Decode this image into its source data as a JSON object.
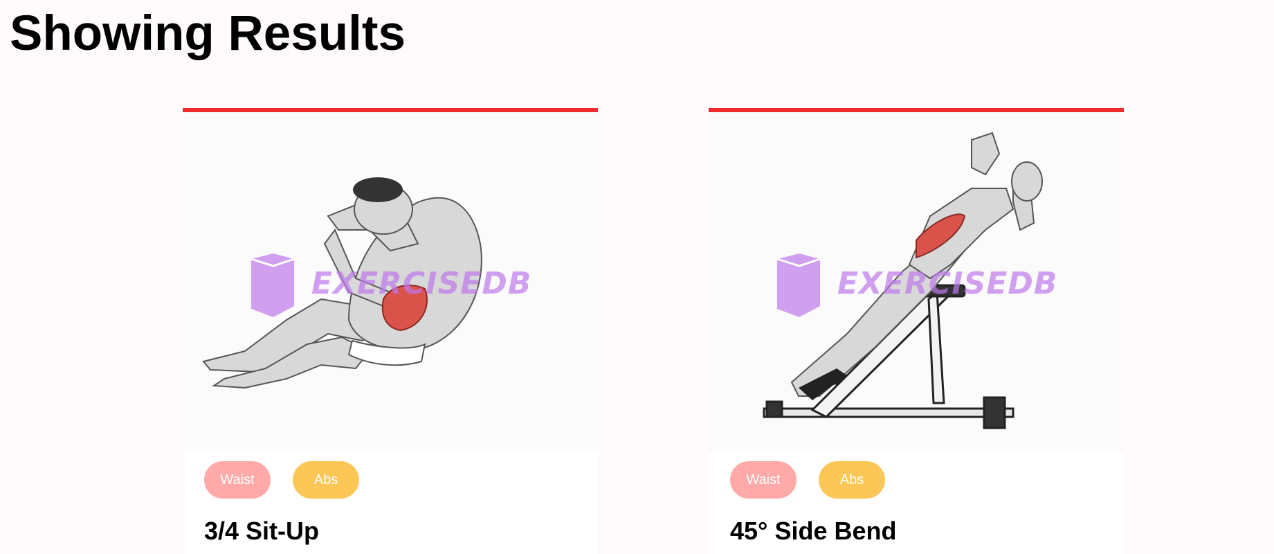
{
  "page": {
    "title": "Showing Results"
  },
  "watermark": {
    "text": "EXERCISEDB",
    "icon": "cube-logo-icon"
  },
  "cards": [
    {
      "tags": {
        "body_part": "Waist",
        "target": "Abs"
      },
      "name": "3/4 Sit-Up",
      "image_icon": "sit-up-figure-illustration"
    },
    {
      "tags": {
        "body_part": "Waist",
        "target": "Abs"
      },
      "name": "45° Side Bend",
      "image_icon": "side-bend-bench-illustration"
    }
  ],
  "colors": {
    "accent_border": "#ef2b2f",
    "body_part_tag": "#ffa9a9",
    "target_tag": "#fcc757",
    "watermark": "#c98ae8",
    "muscle_highlight": "#d9534a"
  }
}
